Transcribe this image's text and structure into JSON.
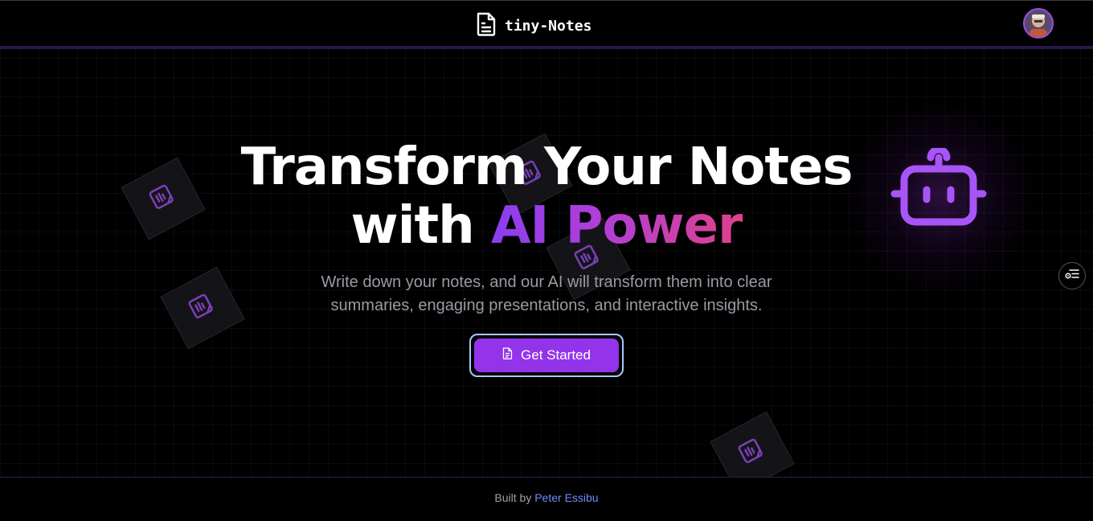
{
  "header": {
    "brand_name": "tiny-Notes",
    "brand_icon": "document-icon",
    "avatar": "user-avatar"
  },
  "hero": {
    "title_line1": "Transform Your Notes",
    "title_line2_prefix": "with ",
    "title_line2_accent": "AI Power",
    "subtitle_line1": "Write down your notes, and our AI will transform them into clear",
    "subtitle_line2": "summaries, engaging presentations, and interactive insights.",
    "cta_label": "Get Started",
    "cta_icon": "document-icon",
    "mascot_icon": "robot-icon"
  },
  "side_button": {
    "icon": "settings-list-icon"
  },
  "footer": {
    "prefix": "Built by",
    "author": "Peter Essibu"
  },
  "colors": {
    "background": "#000000",
    "accent_purple": "#9333ea",
    "gradient_start": "#8b3df0",
    "gradient_end": "#e0418a",
    "ring": "#a8c8ff",
    "link": "#6d8cff"
  }
}
